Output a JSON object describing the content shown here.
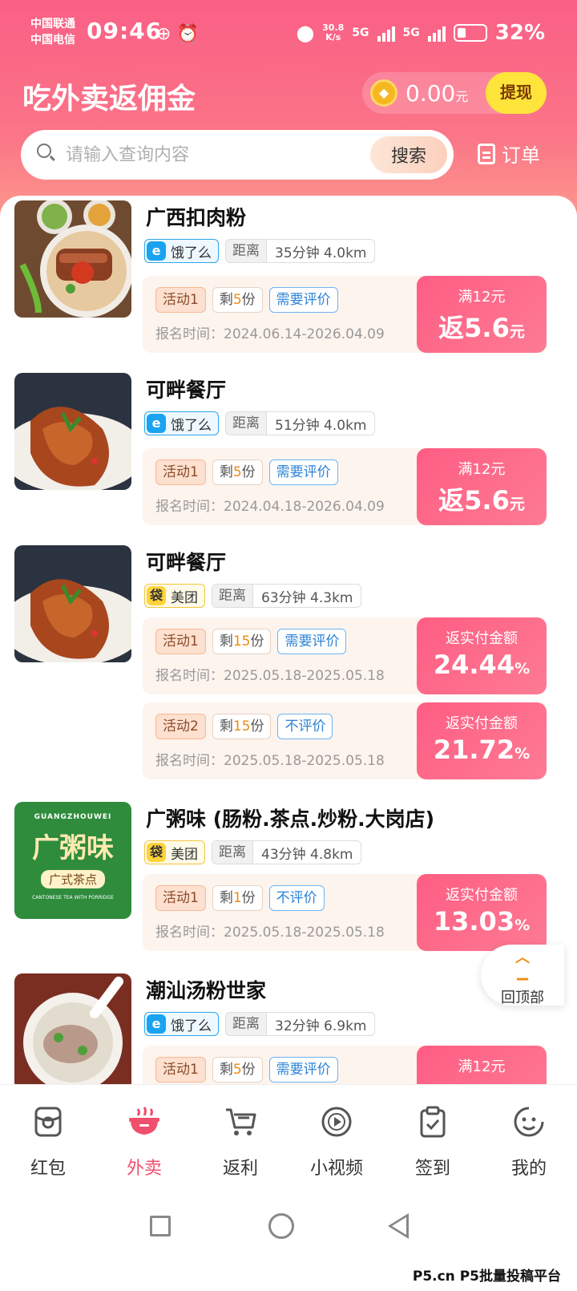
{
  "status_bar": {
    "carrier1": "中国联通",
    "carrier2": "中国电信",
    "time": "09:46",
    "net_speed": "30.8",
    "net_unit": "K/s",
    "sim1": "5G",
    "sim2": "5G",
    "battery": "32%"
  },
  "header": {
    "title": "吃外卖返佣金",
    "balance": "0.00",
    "balance_unit": "元",
    "withdraw_label": "提现",
    "search_placeholder": "请输入查询内容",
    "search_button": "搜索",
    "orders_label": "订单"
  },
  "restaurants": [
    {
      "name": "广西扣肉粉",
      "platform": "饿了么",
      "distance_label": "距离",
      "distance": "35分钟 4.0km",
      "activities": [
        {
          "label": "活动1",
          "remaining_prefix": "剩",
          "remaining": "5",
          "remaining_suffix": "份",
          "review": "需要评价",
          "date": "报名时间：2024.06.14-2026.04.09",
          "rebate_top": "满12元",
          "rebate_prefix": "返",
          "rebate_value": "5.6",
          "rebate_unit": "元"
        }
      ]
    },
    {
      "name": "可畔餐厅",
      "platform": "饿了么",
      "distance_label": "距离",
      "distance": "51分钟 4.0km",
      "activities": [
        {
          "label": "活动1",
          "remaining_prefix": "剩",
          "remaining": "5",
          "remaining_suffix": "份",
          "review": "需要评价",
          "date": "报名时间：2024.04.18-2026.04.09",
          "rebate_top": "满12元",
          "rebate_prefix": "返",
          "rebate_value": "5.6",
          "rebate_unit": "元"
        }
      ]
    },
    {
      "name": "可畔餐厅",
      "platform": "美团",
      "distance_label": "距离",
      "distance": "63分钟 4.3km",
      "activities": [
        {
          "label": "活动1",
          "remaining_prefix": "剩",
          "remaining": "15",
          "remaining_suffix": "份",
          "review": "需要评价",
          "date": "报名时间：2025.05.18-2025.05.18",
          "rebate_top": "返实付金额",
          "rebate_prefix": "",
          "rebate_value": "24.44",
          "rebate_unit": "%"
        },
        {
          "label": "活动2",
          "remaining_prefix": "剩",
          "remaining": "15",
          "remaining_suffix": "份",
          "review": "不评价",
          "date": "报名时间：2025.05.18-2025.05.18",
          "rebate_top": "返实付金额",
          "rebate_prefix": "",
          "rebate_value": "21.72",
          "rebate_unit": "%"
        }
      ]
    },
    {
      "name": "广粥味 (肠粉.茶点.炒粉.大岗店)",
      "platform": "美团",
      "distance_label": "距离",
      "distance": "43分钟 4.8km",
      "logo_text_top": "GUANGZHOUWEI",
      "logo_text_main": "广粥味",
      "logo_text_sub": "广式茶点",
      "logo_text_bottom": "CANTONESE TEA WITH PORRIDGE",
      "activities": [
        {
          "label": "活动1",
          "remaining_prefix": "剩",
          "remaining": "1",
          "remaining_suffix": "份",
          "review": "不评价",
          "date": "报名时间：2025.05.18-2025.05.18",
          "rebate_top": "返实付金额",
          "rebate_prefix": "",
          "rebate_value": "13.03",
          "rebate_unit": "%"
        }
      ]
    },
    {
      "name": "潮汕汤粉世家",
      "platform": "饿了么",
      "distance_label": "距离",
      "distance": "32分钟 6.9km",
      "activities": [
        {
          "label": "活动1",
          "remaining_prefix": "剩",
          "remaining": "5",
          "remaining_suffix": "份",
          "review": "需要评价",
          "date": "",
          "rebate_top": "满12元",
          "rebate_prefix": "",
          "rebate_value": "",
          "rebate_unit": ""
        }
      ]
    }
  ],
  "back_to_top": "回顶部",
  "tabs": [
    {
      "label": "红包",
      "icon": "red-envelope-icon"
    },
    {
      "label": "外卖",
      "icon": "food-bowl-icon",
      "active": true
    },
    {
      "label": "返利",
      "icon": "cart-icon"
    },
    {
      "label": "小视频",
      "icon": "play-icon"
    },
    {
      "label": "签到",
      "icon": "checkin-icon"
    },
    {
      "label": "我的",
      "icon": "profile-face-icon"
    }
  ],
  "watermark": "P5.cn P5批量投稿平台",
  "colors": {
    "header_gradient_top": "#fa5f86",
    "rebate_pink": "#ff5d83",
    "withdraw_yellow": "#ffe43c",
    "active_tab": "#f04f6d"
  }
}
